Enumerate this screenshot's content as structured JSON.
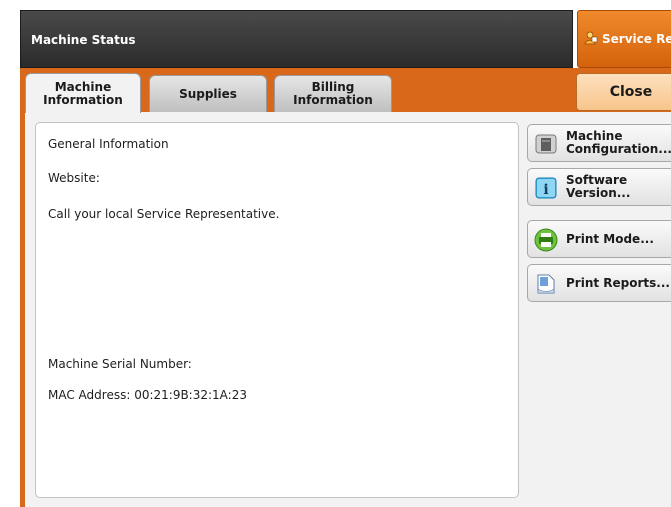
{
  "header": {
    "title": "Machine Status",
    "service_label": "Service Rep"
  },
  "tabs": [
    {
      "label": "Machine\nInformation",
      "active": true
    },
    {
      "label": "Supplies",
      "active": false
    },
    {
      "label": "Billing\nInformation",
      "active": false
    }
  ],
  "close_label": "Close",
  "info": {
    "general": "General Information",
    "website": "Website:",
    "call": "Call your local Service Representative.",
    "serial": "Machine Serial Number:",
    "mac": "MAC Address: 00:21:9B:32:1A:23"
  },
  "side_buttons": [
    {
      "label": "Machine\nConfiguration...",
      "icon": "machine-icon"
    },
    {
      "label": "Software\nVersion...",
      "icon": "info-icon"
    },
    {
      "label": "Print Mode...",
      "icon": "print-mode-icon"
    },
    {
      "label": "Print Reports...",
      "icon": "report-icon"
    }
  ],
  "colors": {
    "accent_orange": "#d9681a",
    "header_dark": "#3a3a3a",
    "close_button": "#f8c58b"
  }
}
